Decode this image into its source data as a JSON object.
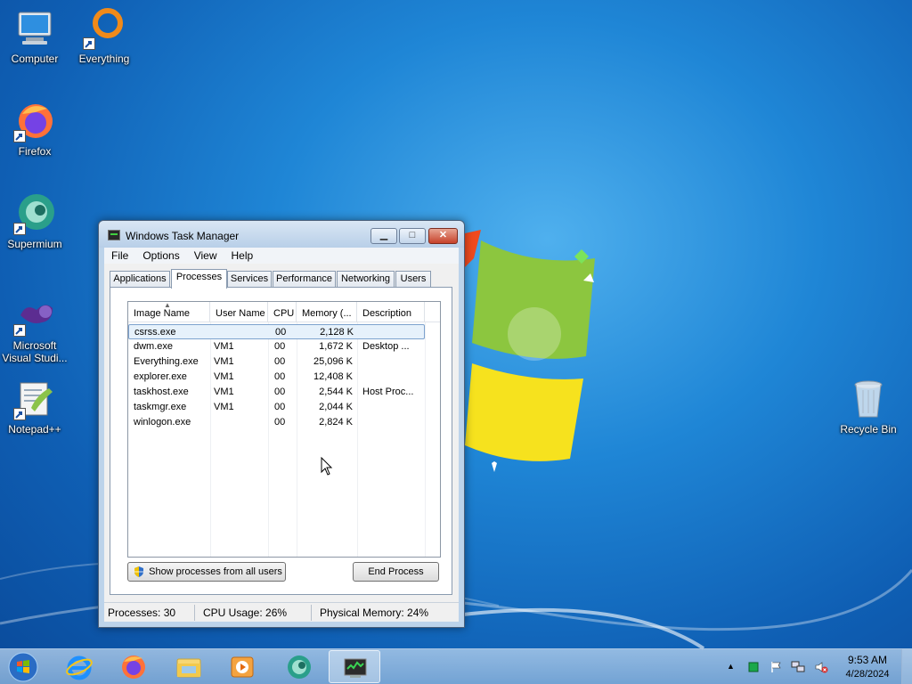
{
  "desktop": {
    "icons": [
      {
        "label": "Computer"
      },
      {
        "label": "Everything"
      },
      {
        "label": "Firefox"
      },
      {
        "label": "Supermium"
      },
      {
        "label": "Microsoft\nVisual Studi..."
      },
      {
        "label": "Notepad++"
      },
      {
        "label": "Recycle Bin"
      }
    ]
  },
  "window": {
    "title": "Windows Task Manager",
    "controls": {
      "minimize": "▁",
      "maximize": "□",
      "close": "✕"
    },
    "menu": [
      "File",
      "Options",
      "View",
      "Help"
    ],
    "tabs": [
      "Applications",
      "Processes",
      "Services",
      "Performance",
      "Networking",
      "Users"
    ],
    "active_tab": "Processes",
    "columns": [
      "Image Name",
      "User Name",
      "CPU",
      "Memory (...",
      "Description"
    ],
    "rows": [
      {
        "name": "csrss.exe",
        "user": "",
        "cpu": "00",
        "mem": "2,128 K",
        "desc": ""
      },
      {
        "name": "dwm.exe",
        "user": "VM1",
        "cpu": "00",
        "mem": "1,672 K",
        "desc": "Desktop ..."
      },
      {
        "name": "Everything.exe",
        "user": "VM1",
        "cpu": "00",
        "mem": "25,096 K",
        "desc": ""
      },
      {
        "name": "explorer.exe",
        "user": "VM1",
        "cpu": "00",
        "mem": "12,408 K",
        "desc": ""
      },
      {
        "name": "taskhost.exe",
        "user": "VM1",
        "cpu": "00",
        "mem": "2,544 K",
        "desc": "Host Proc..."
      },
      {
        "name": "taskmgr.exe",
        "user": "VM1",
        "cpu": "00",
        "mem": "2,044 K",
        "desc": ""
      },
      {
        "name": "winlogon.exe",
        "user": "",
        "cpu": "00",
        "mem": "2,824 K",
        "desc": ""
      }
    ],
    "show_all_label": "Show processes from all users",
    "end_process_label": "End Process",
    "status": {
      "processes": "Processes: 30",
      "cpu": "CPU Usage: 26%",
      "memory": "Physical Memory: 24%"
    }
  },
  "taskbar": {
    "items": [
      "start",
      "internet-explorer",
      "firefox",
      "file-explorer",
      "media-player",
      "supermium",
      "task-manager"
    ],
    "clock": {
      "time": "9:53 AM",
      "date": "4/28/2024"
    }
  }
}
